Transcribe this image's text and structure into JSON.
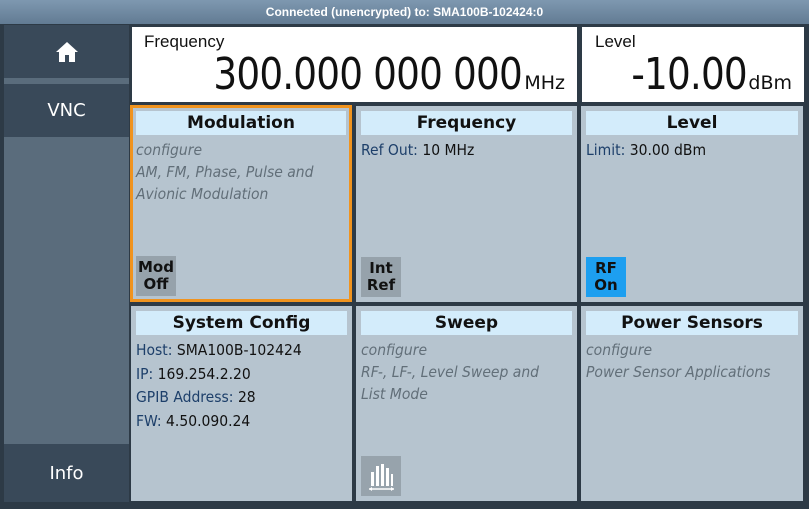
{
  "titlebar": {
    "text": "Connected (unencrypted) to: SMA100B-102424:0"
  },
  "sidebar": {
    "home_icon": "home-icon",
    "vnc_label": "VNC",
    "info_label": "Info"
  },
  "frequency_display": {
    "label": "Frequency",
    "value": "300.000 000 000",
    "unit": "MHz"
  },
  "level_display": {
    "label": "Level",
    "value": "-10.00",
    "unit": "dBm"
  },
  "tiles": {
    "modulation": {
      "title": "Modulation",
      "line1": "configure",
      "line2": "AM, FM, Phase, Pulse and",
      "line3": "Avionic Modulation",
      "button_line1": "Mod",
      "button_line2": "Off"
    },
    "frequency": {
      "title": "Frequency",
      "key": "Ref Out:",
      "value": "10 MHz",
      "button_line1": "Int",
      "button_line2": "Ref"
    },
    "level": {
      "title": "Level",
      "key": "Limit:",
      "value": "30.00 dBm",
      "button_line1": "RF",
      "button_line2": "On"
    },
    "system_config": {
      "title": "System Config",
      "host_key": "Host:",
      "host_value": "SMA100B-102424",
      "ip_key": "IP:",
      "ip_value": "169.254.2.20",
      "gpib_key": "GPIB Address:",
      "gpib_value": "28",
      "fw_key": "FW:",
      "fw_value": "4.50.090.24"
    },
    "sweep": {
      "title": "Sweep",
      "line1": "configure",
      "line2": "RF-, LF-, Level Sweep and",
      "line3": "List Mode",
      "icon": "sweep-icon"
    },
    "power_sensors": {
      "title": "Power Sensors",
      "line1": "configure",
      "line2": "Power Sensor Applications"
    }
  },
  "colors": {
    "accent_selected": "#f0931e",
    "rf_on": "#1d9ff0",
    "tile_bg": "#b6c4cf",
    "tile_header": "#d3ecfb"
  }
}
